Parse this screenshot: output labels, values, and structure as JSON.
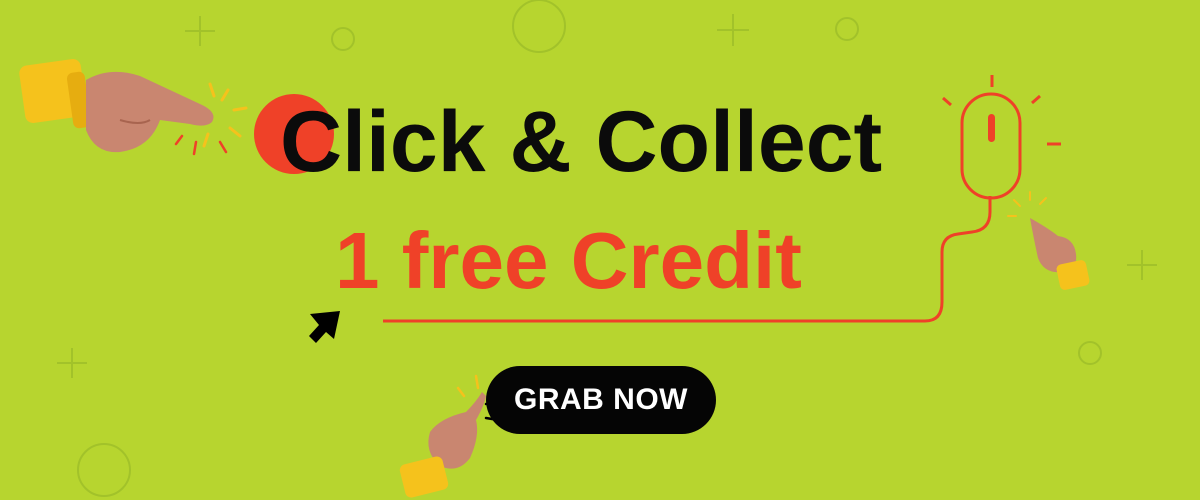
{
  "banner": {
    "headline_first_letter": "C",
    "headline_rest": "lick & Collect",
    "subheadline": "1 free Credit",
    "cta_label": "GRAB NOW"
  },
  "colors": {
    "background": "#b7d52f",
    "accent": "#ef4128",
    "headline_text": "#0b0b0b",
    "button": "#050505",
    "button_text": "#ffffff",
    "cuff": "#f5c21c",
    "skin": "#c98670"
  },
  "icons": [
    "pointing-hand-icon",
    "computer-mouse-icon",
    "cursor-arrow-icon",
    "plus-icon",
    "circle-icon",
    "click-burst-icon"
  ]
}
